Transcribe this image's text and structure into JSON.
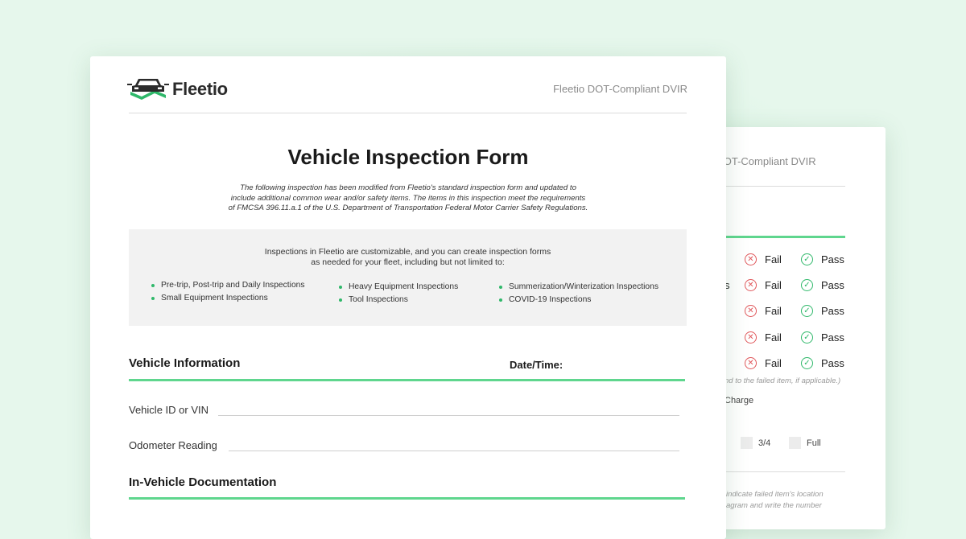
{
  "back_sheet": {
    "header": "tio DOT-Compliant DVIR",
    "rows": [
      {
        "stub": "",
        "fail": "Fail",
        "pass": "Pass"
      },
      {
        "stub": "s",
        "fail": "Fail",
        "pass": "Pass"
      },
      {
        "stub": "",
        "fail": "Fail",
        "pass": "Pass"
      },
      {
        "stub": "",
        "fail": "Fail",
        "pass": "Pass"
      },
      {
        "stub": "",
        "fail": "Fail",
        "pass": "Pass"
      }
    ],
    "failed_note": "nd to the failed item, if applicable.)",
    "charge_label": "Charge",
    "fuel_levels": [
      "3/4",
      "Full"
    ],
    "diagram_note_1": "indicate failed item's location",
    "diagram_note_2": "agram and write the number"
  },
  "front_sheet": {
    "brand": "Fleetio",
    "brand_logo_icon": "car-logo-icon",
    "header_right": "Fleetio DOT-Compliant DVIR",
    "title": "Vehicle Inspection Form",
    "intro_lines": [
      "The following inspection has been modified from Fleetio's standard inspection form and updated to",
      "include additional common wear and/or safety items. The items in this inspection meet the requirements",
      "of FMCSA 396.11.a.1 of the U.S. Department of Transportation Federal Motor Carrier Safety Regulations."
    ],
    "info_box": {
      "lead_lines": [
        "Inspections in Fleetio are customizable, and you can create inspection forms",
        "as needed for your fleet, including but not limited to:"
      ],
      "columns": [
        [
          "Pre-trip, Post-trip and Daily Inspections",
          "Small Equipment Inspections"
        ],
        [
          "Heavy Equipment Inspections",
          "Tool Inspections"
        ],
        [
          "Summerization/Winterization Inspections",
          "COVID-19 Inspections"
        ]
      ]
    },
    "vehicle_info": {
      "heading": "Vehicle Information",
      "date_time_label": "Date/Time:",
      "vehicle_id_label": "Vehicle ID or VIN",
      "odometer_label": "Odometer Reading"
    },
    "documentation_heading": "In-Vehicle Documentation"
  },
  "colors": {
    "background": "#e6f7ec",
    "accent_green": "#5fd68e",
    "pass_green": "#2fb86a",
    "fail_red": "#e0575b"
  }
}
